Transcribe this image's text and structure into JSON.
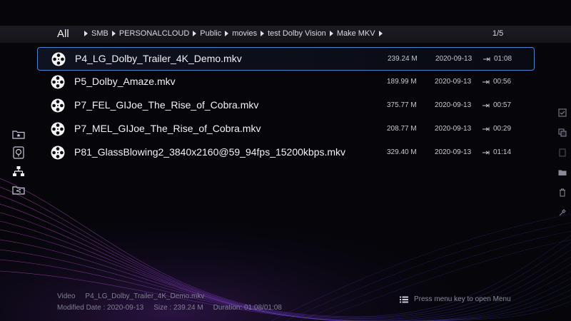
{
  "header": {
    "all_label": "All",
    "breadcrumb": [
      "SMB",
      "PERSONALCLOUD",
      "Public",
      "movies",
      "test Dolby Vision",
      "Make MKV"
    ],
    "page_indicator": "1/5"
  },
  "files": [
    {
      "name": "P4_LG_Dolby_Trailer_4K_Demo.mkv",
      "size": "239.24 M",
      "date": "2020-09-13",
      "duration": "01:08",
      "icon": "film-reel-icon"
    },
    {
      "name": "P5_Dolby_Amaze.mkv",
      "size": "189.99 M",
      "date": "2020-09-13",
      "duration": "00:56",
      "icon": "film-reel-icon"
    },
    {
      "name": "P7_FEL_GIJoe_The_Rise_of_Cobra.mkv",
      "size": "375.77 M",
      "date": "2020-09-13",
      "duration": "00:57",
      "icon": "film-reel-icon"
    },
    {
      "name": "P7_MEL_GIJoe_The_Rise_of_Cobra.mkv",
      "size": "208.77 M",
      "date": "2020-09-13",
      "duration": "00:29",
      "icon": "film-reel-icon"
    },
    {
      "name": "P81_GlassBlowing2_3840x2160@59_94fps_15200kbps.mkv",
      "size": "329.40 M",
      "date": "2020-09-13",
      "duration": "01:14",
      "icon": "film-reel-icon"
    }
  ],
  "selected_index": 0,
  "left_nav": [
    "favorite-folder-icon",
    "recent-icon",
    "network-icon",
    "shared-folder-icon"
  ],
  "right_nav": [
    "check-icon",
    "copy-icon",
    "paste-icon",
    "move-folder-icon",
    "delete-icon",
    "tools-icon"
  ],
  "footer": {
    "type_label": "Video",
    "type_value": "P4_LG_Dolby_Trailer_4K_Demo.mkv",
    "modified": "Modified Date : 2020-09-13",
    "size": "Size : 239.24 M",
    "duration": "Duration: 01:08/01:08",
    "menu_hint": "Press menu key to open Menu"
  },
  "colors": {
    "accent": "#4f7fd6",
    "background": "#05050a"
  }
}
